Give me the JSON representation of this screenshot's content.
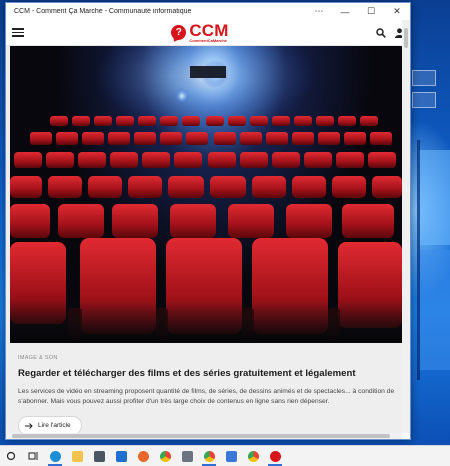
{
  "window": {
    "title": "CCM - Comment Ça Marche - Communauté informatique",
    "controls": {
      "more": "⋯",
      "minimize": "—",
      "maximize": "☐",
      "close": "✕"
    }
  },
  "site": {
    "logo_main": "CCM",
    "logo_sub": "CommentCaMarche",
    "logo_badge": "?"
  },
  "article": {
    "category": "IMAGE & SON",
    "title": "Regarder et télécharger des films et des séries gratuitement et légalement",
    "excerpt": "Les services de vidéo en streaming proposent quantité de films, de séries, de dessins animés et de spectacles... à condition de s'abonner. Mais vous pouvez aussi profiter d'un très large choix de contenus en ligne sans rien dépenser.",
    "read_label": "Lire l'article",
    "read_icon": "arrow-right-icon"
  },
  "colors": {
    "brand": "#d7141a",
    "seat": "#b3151d",
    "desktop": "#0f63cf"
  },
  "taskbar": {
    "items": [
      {
        "name": "start-search-icon",
        "glyph": "○"
      },
      {
        "name": "task-view-icon",
        "glyph": "▤"
      },
      {
        "name": "edge-icon",
        "color": "#1a8fd8"
      },
      {
        "name": "folder-icon",
        "color": "#f2c34a"
      },
      {
        "name": "store-icon",
        "color": "#4b5563"
      },
      {
        "name": "mail-icon",
        "color": "#1e6fd0"
      },
      {
        "name": "firefox-icon",
        "color": "#e8692b"
      },
      {
        "name": "chrome-icon",
        "color": "#34a853"
      },
      {
        "name": "unknown-app-icon",
        "color": "#6b7280"
      },
      {
        "name": "chrome-icon-2",
        "color": "#ea4335"
      },
      {
        "name": "code-editor-icon",
        "color": "#3a77d8"
      },
      {
        "name": "chrome-icon-3",
        "color": "#fbbc05"
      },
      {
        "name": "ccm-app-icon",
        "color": "#d7141a"
      }
    ]
  }
}
